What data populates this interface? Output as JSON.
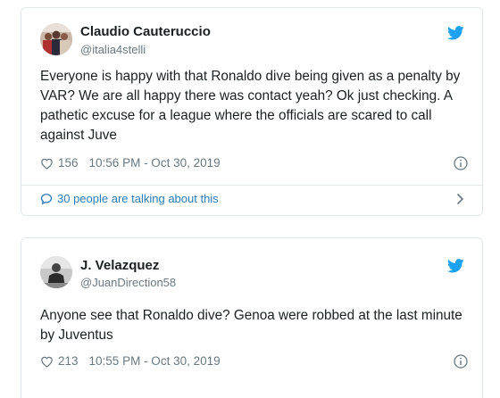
{
  "tweets": [
    {
      "name": "Claudio Cauteruccio",
      "handle": "@italia4stelli",
      "text": "Everyone is happy with that Ronaldo dive being given as a penalty by VAR? We are all happy there was contact yeah? Ok just checking. A pathetic excuse for a league where the officials are scared to call against Juve",
      "likes": "156",
      "timestamp": "10:56 PM - Oct 30, 2019",
      "talking": "30 people are talking about this"
    },
    {
      "name": "J. Velazquez",
      "handle": "@JuanDirection58",
      "text": "Anyone see that Ronaldo dive? Genoa were robbed at the last minute by Juventus",
      "likes": "213",
      "timestamp": "10:55 PM - Oct 30, 2019"
    }
  ],
  "colors": {
    "twitter_blue": "#1da1f2",
    "link_blue": "#2b7bb9",
    "meta_gray": "#697882",
    "border": "#e1e8ed"
  },
  "icons": [
    "twitter-bird-icon",
    "heart-icon",
    "info-icon",
    "speech-bubble-icon",
    "chevron-right-icon"
  ]
}
